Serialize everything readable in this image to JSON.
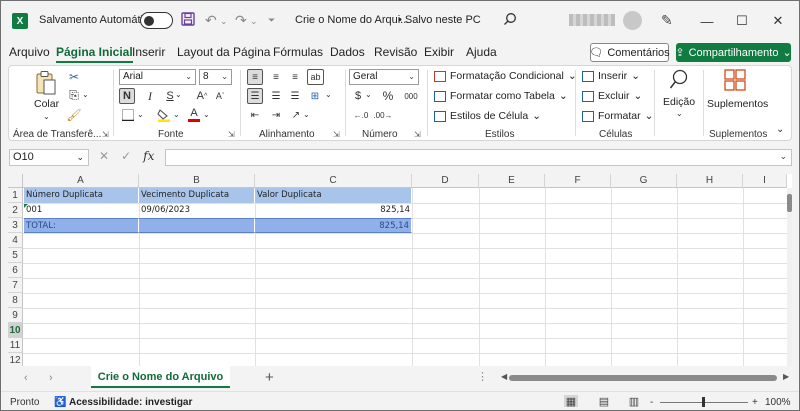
{
  "titlebar": {
    "autosave_label": "Salvamento Automático",
    "doc_title": "Crie o Nome do Arqui...",
    "doc_status": "• Salvo neste PC",
    "qat_save_icon": "save-icon",
    "qat_undo_icon": "undo-icon",
    "qat_redo_icon": "redo-icon"
  },
  "menu": {
    "tabs": [
      "Arquivo",
      "Página Inicial",
      "Inserir",
      "Layout da Página",
      "Fórmulas",
      "Dados",
      "Revisão",
      "Exibir",
      "Ajuda"
    ],
    "comments_label": "Comentários",
    "share_label": "Compartilhamento"
  },
  "ribbon": {
    "clipboard": {
      "paste_label": "Colar",
      "group_label": "Área de Transferê..."
    },
    "font": {
      "font_name": "Arial",
      "font_size": "8",
      "bold": "N",
      "italic": "I",
      "underline": "S",
      "grow": "A",
      "shrink": "A",
      "group_label": "Fonte"
    },
    "alignment": {
      "group_label": "Alinhamento",
      "wrap": "ab"
    },
    "number": {
      "format": "Geral",
      "currency": "$",
      "percent": "%",
      "thousands": "000",
      "group_label": "Número"
    },
    "styles": {
      "conditional": "Formatação Condicional",
      "table": "Formatar como Tabela",
      "cell_styles": "Estilos de Célula",
      "group_label": "Estilos"
    },
    "cells": {
      "insert": "Inserir",
      "delete": "Excluir",
      "format": "Formatar",
      "group_label": "Células"
    },
    "editing": {
      "label": "Edição"
    },
    "addins": {
      "label": "Suplementos",
      "group_label": "Suplementos"
    }
  },
  "formula_bar": {
    "name_box": "O10",
    "fx": "fx",
    "cancel": "✕",
    "enter": "✓",
    "formula": ""
  },
  "grid": {
    "columns": [
      "A",
      "B",
      "C",
      "D",
      "E",
      "F",
      "G",
      "H",
      "I"
    ],
    "rows": [
      "1",
      "2",
      "3",
      "4",
      "5",
      "6",
      "7",
      "8",
      "9",
      "10",
      "11",
      "12"
    ],
    "selected_row": "10",
    "cells": {
      "A1": "Número Duplicata",
      "B1": "Vecimento Duplicata",
      "C1": "Valor Duplicata",
      "A2": "001",
      "B2": "09/06/2023",
      "C2": "825,14",
      "A3": "TOTAL:",
      "B3": "",
      "C3": "825,14"
    }
  },
  "sheets": {
    "active": "Crie o Nome do Arquivo",
    "add": "+"
  },
  "status": {
    "ready": "Pronto",
    "accessibility": "Acessibilidade: investigar",
    "zoom_minus": "-",
    "zoom_plus": "+",
    "zoom": "100%"
  },
  "colors": {
    "accent": "#107c41",
    "header_fill": "#a9c4ea",
    "total_fill": "#8fb0e8"
  }
}
